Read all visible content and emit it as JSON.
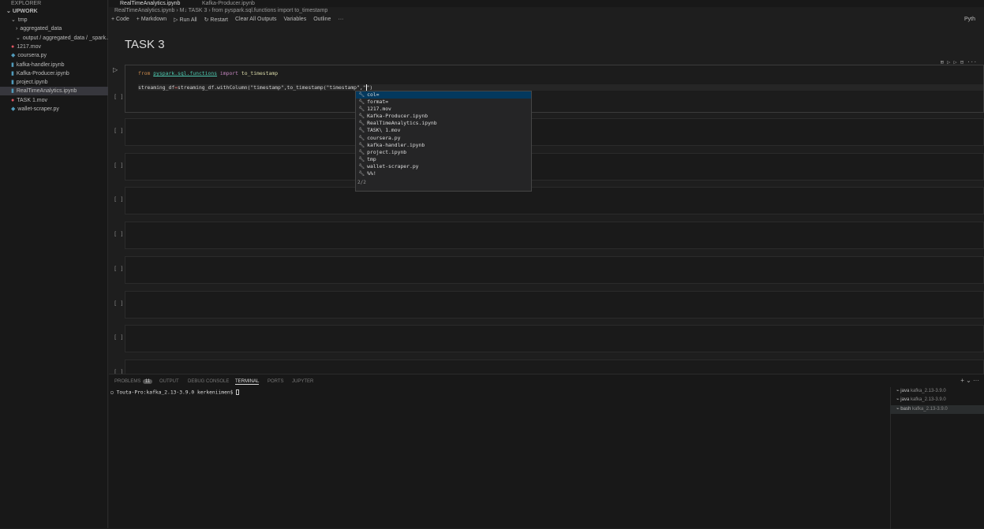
{
  "sidebar": {
    "header": "EXPLORER",
    "root": "UPWORK",
    "items": [
      {
        "label": "tmp",
        "type": "folder-open",
        "indent": 1
      },
      {
        "label": "aggregated_data",
        "type": "folder",
        "indent": 2
      },
      {
        "label": "output / aggregated_data / _spark...",
        "type": "folder-open",
        "indent": 2
      },
      {
        "label": "1217.mov",
        "type": "video",
        "indent": 1
      },
      {
        "label": "coursera.py",
        "type": "python",
        "indent": 1
      },
      {
        "label": "kafka-handler.ipynb",
        "type": "notebook",
        "indent": 1
      },
      {
        "label": "Kafka-Producer.ipynb",
        "type": "notebook",
        "indent": 1
      },
      {
        "label": "project.ipynb",
        "type": "notebook",
        "indent": 1
      },
      {
        "label": "RealTimeAnalytics.ipynb",
        "type": "notebook",
        "indent": 1,
        "selected": true
      },
      {
        "label": "TASK 1.mov",
        "type": "video",
        "indent": 1
      },
      {
        "label": "wallet-scraper.py",
        "type": "python",
        "indent": 1
      }
    ]
  },
  "tabs": [
    "RealTimeAnalytics.ipynb",
    "Kafka-Producer.ipynb"
  ],
  "breadcrumb": [
    "RealTimeAnalytics.ipynb",
    "M↓ TASK 3",
    "from pyspark.sql.functions import to_timestamp"
  ],
  "toolbar": {
    "code": "+ Code",
    "markdown": "+ Markdown",
    "run_all": "▷ Run All",
    "restart": "↻ Restart",
    "clear": "Clear All Outputs",
    "variables": "Variables",
    "outline": "Outline",
    "more": "···",
    "kernel": "Pyth"
  },
  "heading": "TASK 3",
  "cell1": {
    "kw_from": "from",
    "module": "pyspark.sql.functions",
    "kw_import": "import",
    "name": "to_timestamp",
    "line2_a": "streaming_df",
    "op": "=",
    "line2_b": "streaming_df.withColumn(\"timestamp\",to_timestamp(\"timestamp\",\"",
    "line2_c": "\")",
    "label": "[ ]"
  },
  "empty_cell_label": "[ ]",
  "autocomplete": {
    "items": [
      "col=",
      "format=",
      "1217.mov",
      "Kafka-Producer.ipynb",
      "RealTimeAnalytics.ipynb",
      "TASK\\ 1.mov",
      "coursera.py",
      "kafka-handler.ipynb",
      "project.ipynb",
      "tmp",
      "wallet-scraper.py",
      "%%!"
    ],
    "counter": "2/2"
  },
  "panel": {
    "tabs": [
      "PROBLEMS",
      "OUTPUT",
      "DEBUG CONSOLE",
      "TERMINAL",
      "PORTS",
      "JUPYTER"
    ],
    "problems_count": "11",
    "active": "TERMINAL",
    "prompt": "Touta-Pro:kafka_2.13-3.9.0 kerkeniimen$ ",
    "terminals": [
      {
        "name": "java",
        "path": "kafka_2.13-3.9.0"
      },
      {
        "name": "java",
        "path": "kafka_2.13-3.9.0"
      },
      {
        "name": "bash",
        "path": "kafka_2.13-3.9.0"
      }
    ]
  }
}
